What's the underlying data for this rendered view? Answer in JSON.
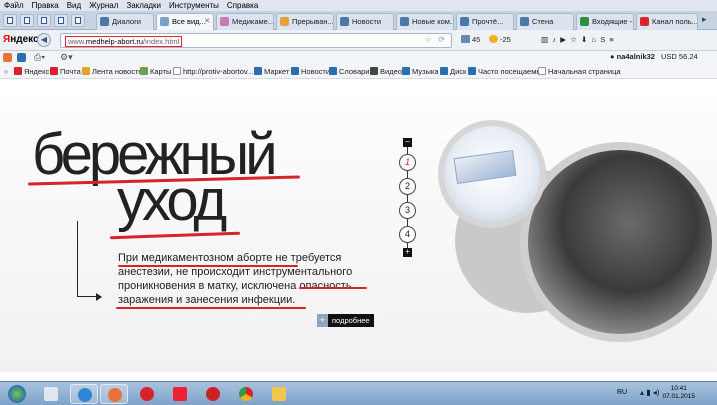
{
  "menu": [
    "Файл",
    "Правка",
    "Вид",
    "Журнал",
    "Закладки",
    "Инструменты",
    "Справка"
  ],
  "tabs": [
    "Диалоги",
    "Все вид...",
    "Медикаме...",
    "Прерыван...",
    "Новости",
    "Новые ком...",
    "Прочтё...",
    "Стена",
    "Входящие -...",
    "Канал поль..."
  ],
  "address": {
    "logo_a": "Я",
    "logo_b": "ндекс",
    "url_host": "www.",
    "url_main": "medhelp-abort.ru",
    "url_path": "/index.html"
  },
  "toolbar": {
    "mail": "45",
    "weather": "-25",
    "user": "na4alnik32",
    "currency": "USD 56.24"
  },
  "bookmarks": [
    "Яндекс",
    "Почта",
    "Лента новостей",
    "Карты",
    "http://protiv-abortov...",
    "Маркет",
    "Новости",
    "Словари",
    "Видео",
    "Музыка",
    "Диск",
    "Часто посещаемые",
    "Начальная страница"
  ],
  "hero": {
    "word1": "бережный",
    "word2": "уход",
    "paragraph": "При медикаментозном аборте не требуется анестезии, не происходит инструментального проникновения в матку, исключена опасность заражения и занесения инфекции.",
    "more_label": "подробнее",
    "more_plus": "+"
  },
  "pager": {
    "minus": "–",
    "plus": "+",
    "items": [
      "1",
      "2",
      "3",
      "4"
    ],
    "active": "1"
  },
  "taskbar": {
    "lang": "RU",
    "time": "10:41",
    "date": "07.01.2015"
  },
  "colors": {
    "accent": "#d8232a",
    "tabbar": "#c8d3e2",
    "taskbar": "#7ea2c9"
  }
}
